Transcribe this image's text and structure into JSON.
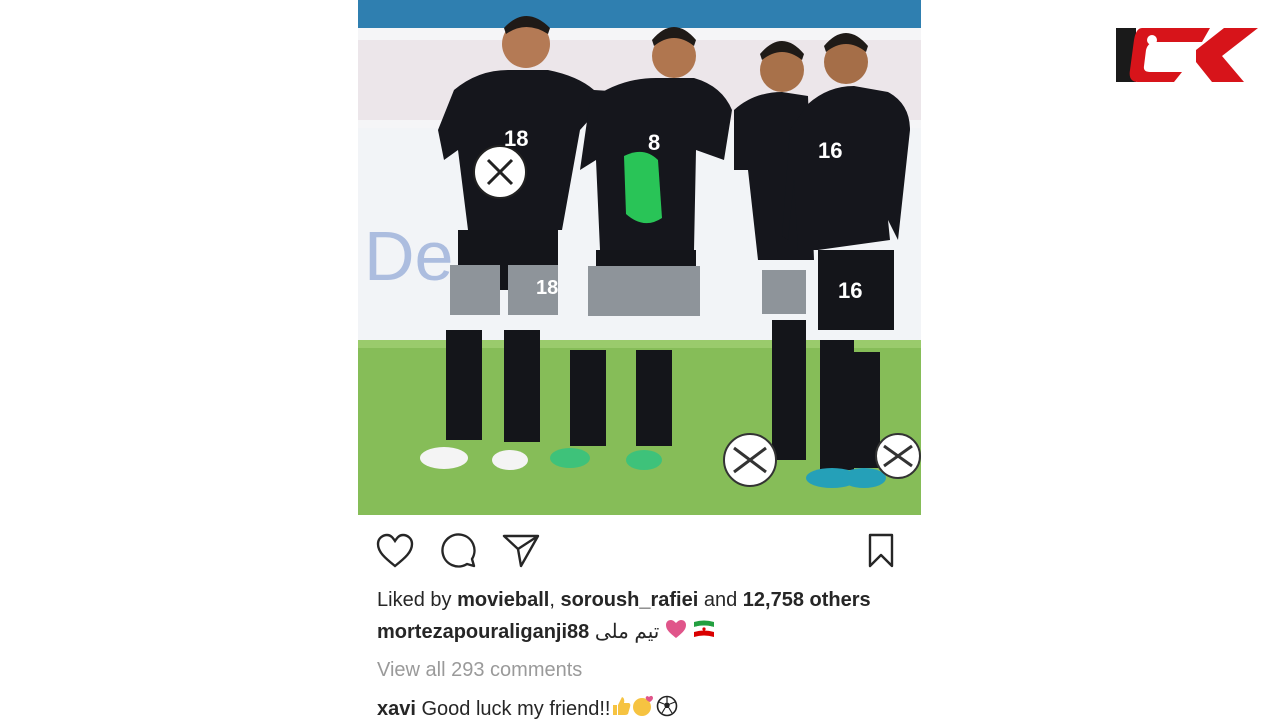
{
  "brand": {
    "logo_name": "rokna-logo",
    "logo_color": "#d7141a",
    "logo_dark": "#1a1a1a"
  },
  "photo": {
    "description_icon": "team-photo",
    "jersey_numbers": [
      "18",
      "8",
      "16"
    ]
  },
  "actions": {
    "like_icon": "heart-icon",
    "comment_icon": "comment-icon",
    "share_icon": "paper-plane-icon",
    "save_icon": "bookmark-icon"
  },
  "likes": {
    "prefix": "Liked by ",
    "user1": "movieball",
    "sep": ", ",
    "user2": "soroush_rafiei",
    "and": " and ",
    "others": "12,758 others"
  },
  "caption": {
    "username": "mortezapouraliganji88",
    "text": "تیم ملی"
  },
  "view_all": "View all 293 comments",
  "comment": {
    "username": "xavi",
    "text": "Good luck my friend!!"
  },
  "colors": {
    "heart": "#e0558a",
    "text": "#262626",
    "muted": "#9a9a9a"
  }
}
